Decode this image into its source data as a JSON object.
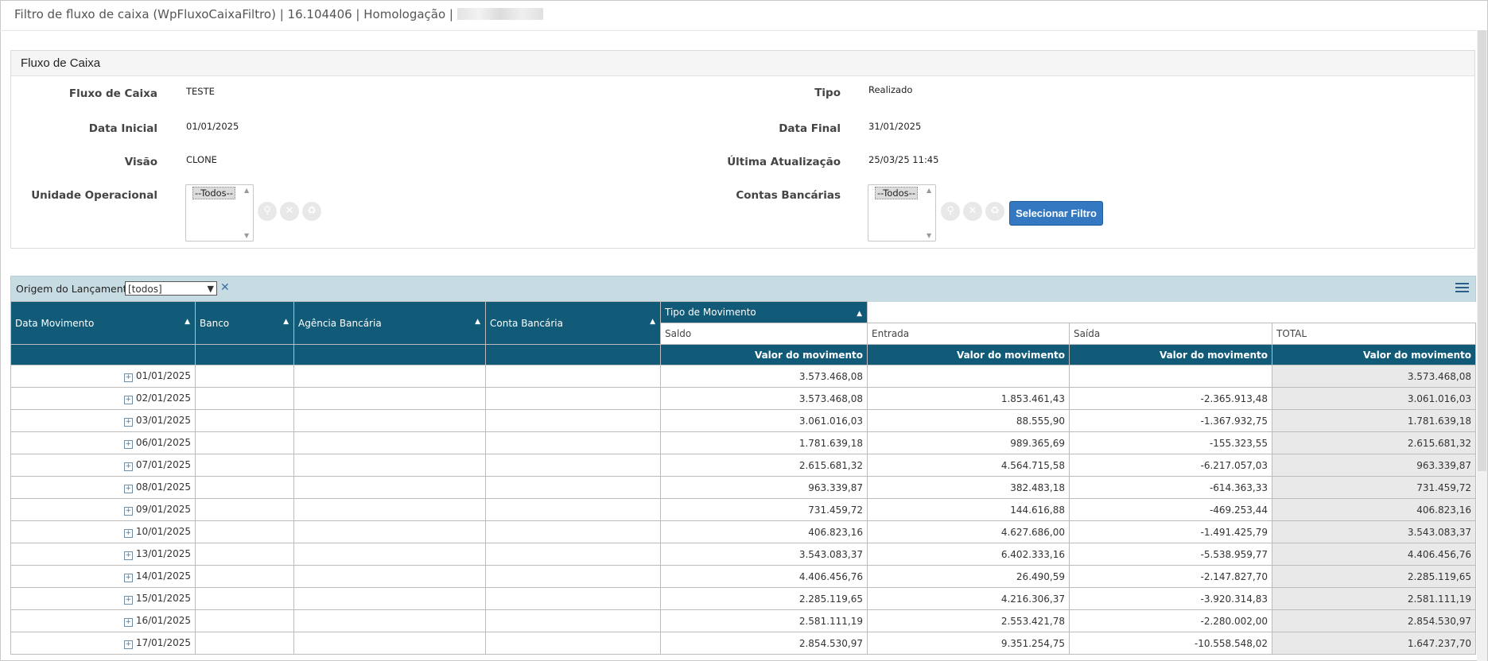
{
  "window": {
    "title": "Filtro de fluxo de caixa (WpFluxoCaixaFiltro) | 16.104406 | Homologação |"
  },
  "panel": {
    "title": "Fluxo de Caixa",
    "fields": {
      "fluxo_label": "Fluxo de Caixa",
      "fluxo_value": "TESTE",
      "tipo_label": "Tipo",
      "tipo_value": "Realizado",
      "data_inicial_label": "Data Inicial",
      "data_inicial_value": "01/01/2025",
      "data_final_label": "Data Final",
      "data_final_value": "31/01/2025",
      "visao_label": "Visão",
      "visao_value": "CLONE",
      "ultima_label": "Última Atualização",
      "ultima_value": "25/03/25 11:45",
      "unidade_label": "Unidade Operacional",
      "unidade_option": "--Todos--",
      "contas_label": "Contas Bancárias",
      "contas_option": "--Todos--"
    },
    "select_filter_label": "Selecionar Filtro"
  },
  "toolbar": {
    "origem_label": "Origem do Lançamento:",
    "origem_value": "[todos]"
  },
  "grid": {
    "headers": {
      "data_movimento": "Data Movimento",
      "banco": "Banco",
      "agencia": "Agência Bancária",
      "conta": "Conta Bancária",
      "tipo_movimento": "Tipo de Movimento",
      "saldo": "Saldo",
      "entrada": "Entrada",
      "saida": "Saída",
      "total": "TOTAL",
      "valor": "Valor do movimento"
    },
    "rows": [
      {
        "date": "01/01/2025",
        "saldo": "3.573.468,08",
        "entrada": "",
        "saida": "",
        "total": "3.573.468,08"
      },
      {
        "date": "02/01/2025",
        "saldo": "3.573.468,08",
        "entrada": "1.853.461,43",
        "saida": "-2.365.913,48",
        "total": "3.061.016,03"
      },
      {
        "date": "03/01/2025",
        "saldo": "3.061.016,03",
        "entrada": "88.555,90",
        "saida": "-1.367.932,75",
        "total": "1.781.639,18"
      },
      {
        "date": "06/01/2025",
        "saldo": "1.781.639,18",
        "entrada": "989.365,69",
        "saida": "-155.323,55",
        "total": "2.615.681,32"
      },
      {
        "date": "07/01/2025",
        "saldo": "2.615.681,32",
        "entrada": "4.564.715,58",
        "saida": "-6.217.057,03",
        "total": "963.339,87"
      },
      {
        "date": "08/01/2025",
        "saldo": "963.339,87",
        "entrada": "382.483,18",
        "saida": "-614.363,33",
        "total": "731.459,72"
      },
      {
        "date": "09/01/2025",
        "saldo": "731.459,72",
        "entrada": "144.616,88",
        "saida": "-469.253,44",
        "total": "406.823,16"
      },
      {
        "date": "10/01/2025",
        "saldo": "406.823,16",
        "entrada": "4.627.686,00",
        "saida": "-1.491.425,79",
        "total": "3.543.083,37"
      },
      {
        "date": "13/01/2025",
        "saldo": "3.543.083,37",
        "entrada": "6.402.333,16",
        "saida": "-5.538.959,77",
        "total": "4.406.456,76"
      },
      {
        "date": "14/01/2025",
        "saldo": "4.406.456,76",
        "entrada": "26.490,59",
        "saida": "-2.147.827,70",
        "total": "2.285.119,65"
      },
      {
        "date": "15/01/2025",
        "saldo": "2.285.119,65",
        "entrada": "4.216.306,37",
        "saida": "-3.920.314,83",
        "total": "2.581.111,19"
      },
      {
        "date": "16/01/2025",
        "saldo": "2.581.111,19",
        "entrada": "2.553.421,78",
        "saida": "-2.280.002,00",
        "total": "2.854.530,97"
      },
      {
        "date": "17/01/2025",
        "saldo": "2.854.530,97",
        "entrada": "9.351.254,75",
        "saida": "-10.558.548,02",
        "total": "1.647.237,70"
      }
    ]
  },
  "icons": {
    "search": "magnifier-icon",
    "clear": "close-icon",
    "reset": "recycle-icon",
    "menu": "hamburger-menu-icon",
    "expand": "plus-box-icon"
  },
  "colors": {
    "header_bg": "#115a78",
    "toolbar_bg": "#c7dbe3",
    "button_bg": "#3378c0",
    "total_bg": "#e9e9e9"
  }
}
